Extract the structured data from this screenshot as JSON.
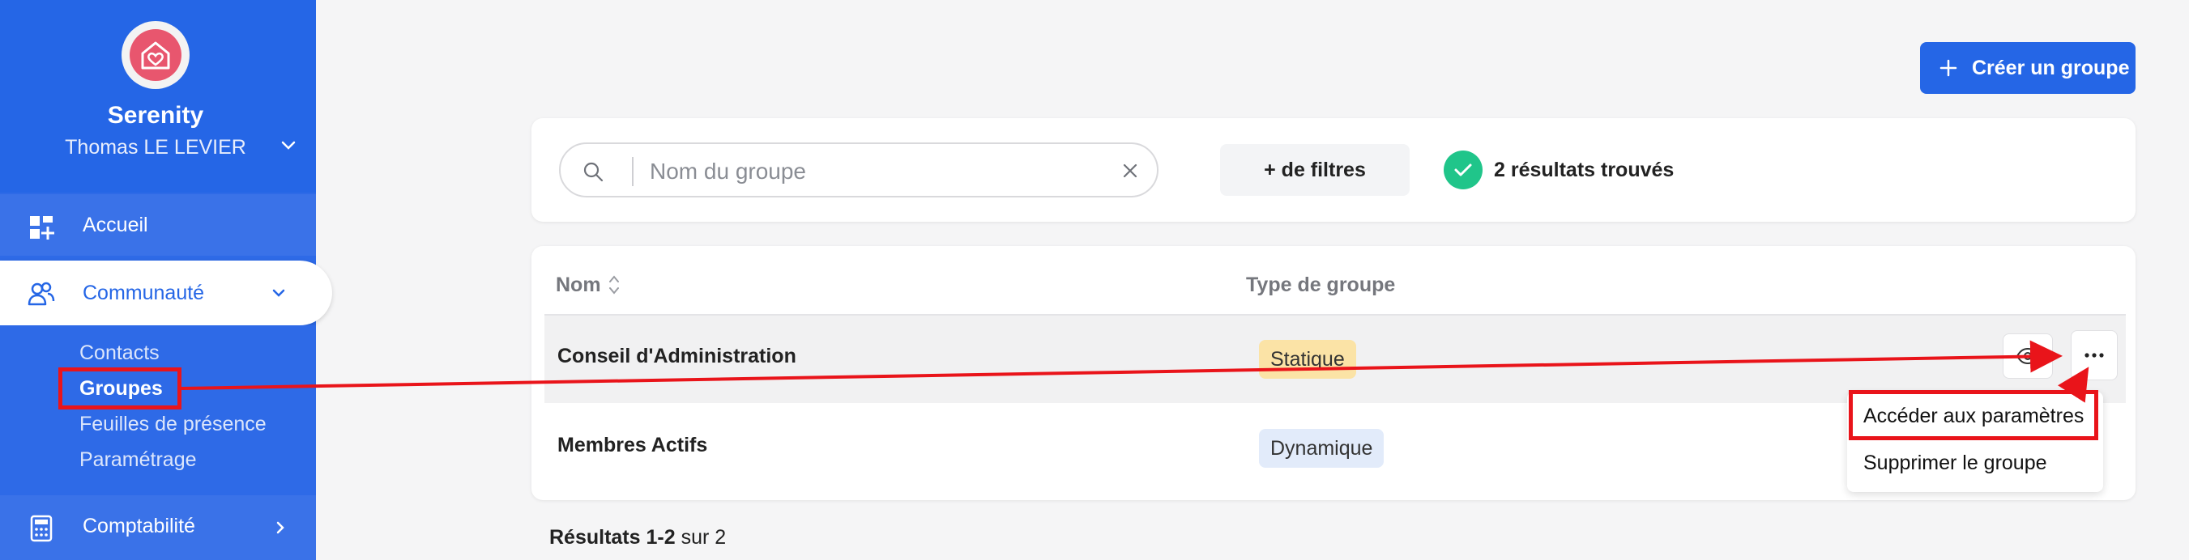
{
  "sidebar": {
    "org_name": "Serenity",
    "user_name": "Thomas LE LEVIER",
    "nav": {
      "home": "Accueil",
      "community": "Communauté",
      "accounting": "Comptabilité"
    },
    "community_sub": [
      "Contacts",
      "Groupes",
      "Feuilles de présence",
      "Paramétrage"
    ],
    "active_sub": "Groupes"
  },
  "header": {
    "create_button": "Créer un groupe"
  },
  "filters": {
    "search_placeholder": "Nom du groupe",
    "more_filters": "+ de filtres",
    "results_found": "2 résultats trouvés"
  },
  "table": {
    "columns": [
      "Nom",
      "Type de groupe"
    ],
    "rows": [
      {
        "name": "Conseil d'Administration",
        "type": "Statique"
      },
      {
        "name": "Membres Actifs",
        "type": "Dynamique"
      }
    ]
  },
  "row_menu": {
    "items": [
      "Accéder aux paramètres",
      "Supprimer le groupe"
    ]
  },
  "pagination": {
    "range": "Résultats 1-2",
    "total": "sur 2"
  },
  "colors": {
    "sidebar": "#2566e6",
    "accent": "#2566e6",
    "success": "#20c58a",
    "annotation": "#e9141a"
  }
}
